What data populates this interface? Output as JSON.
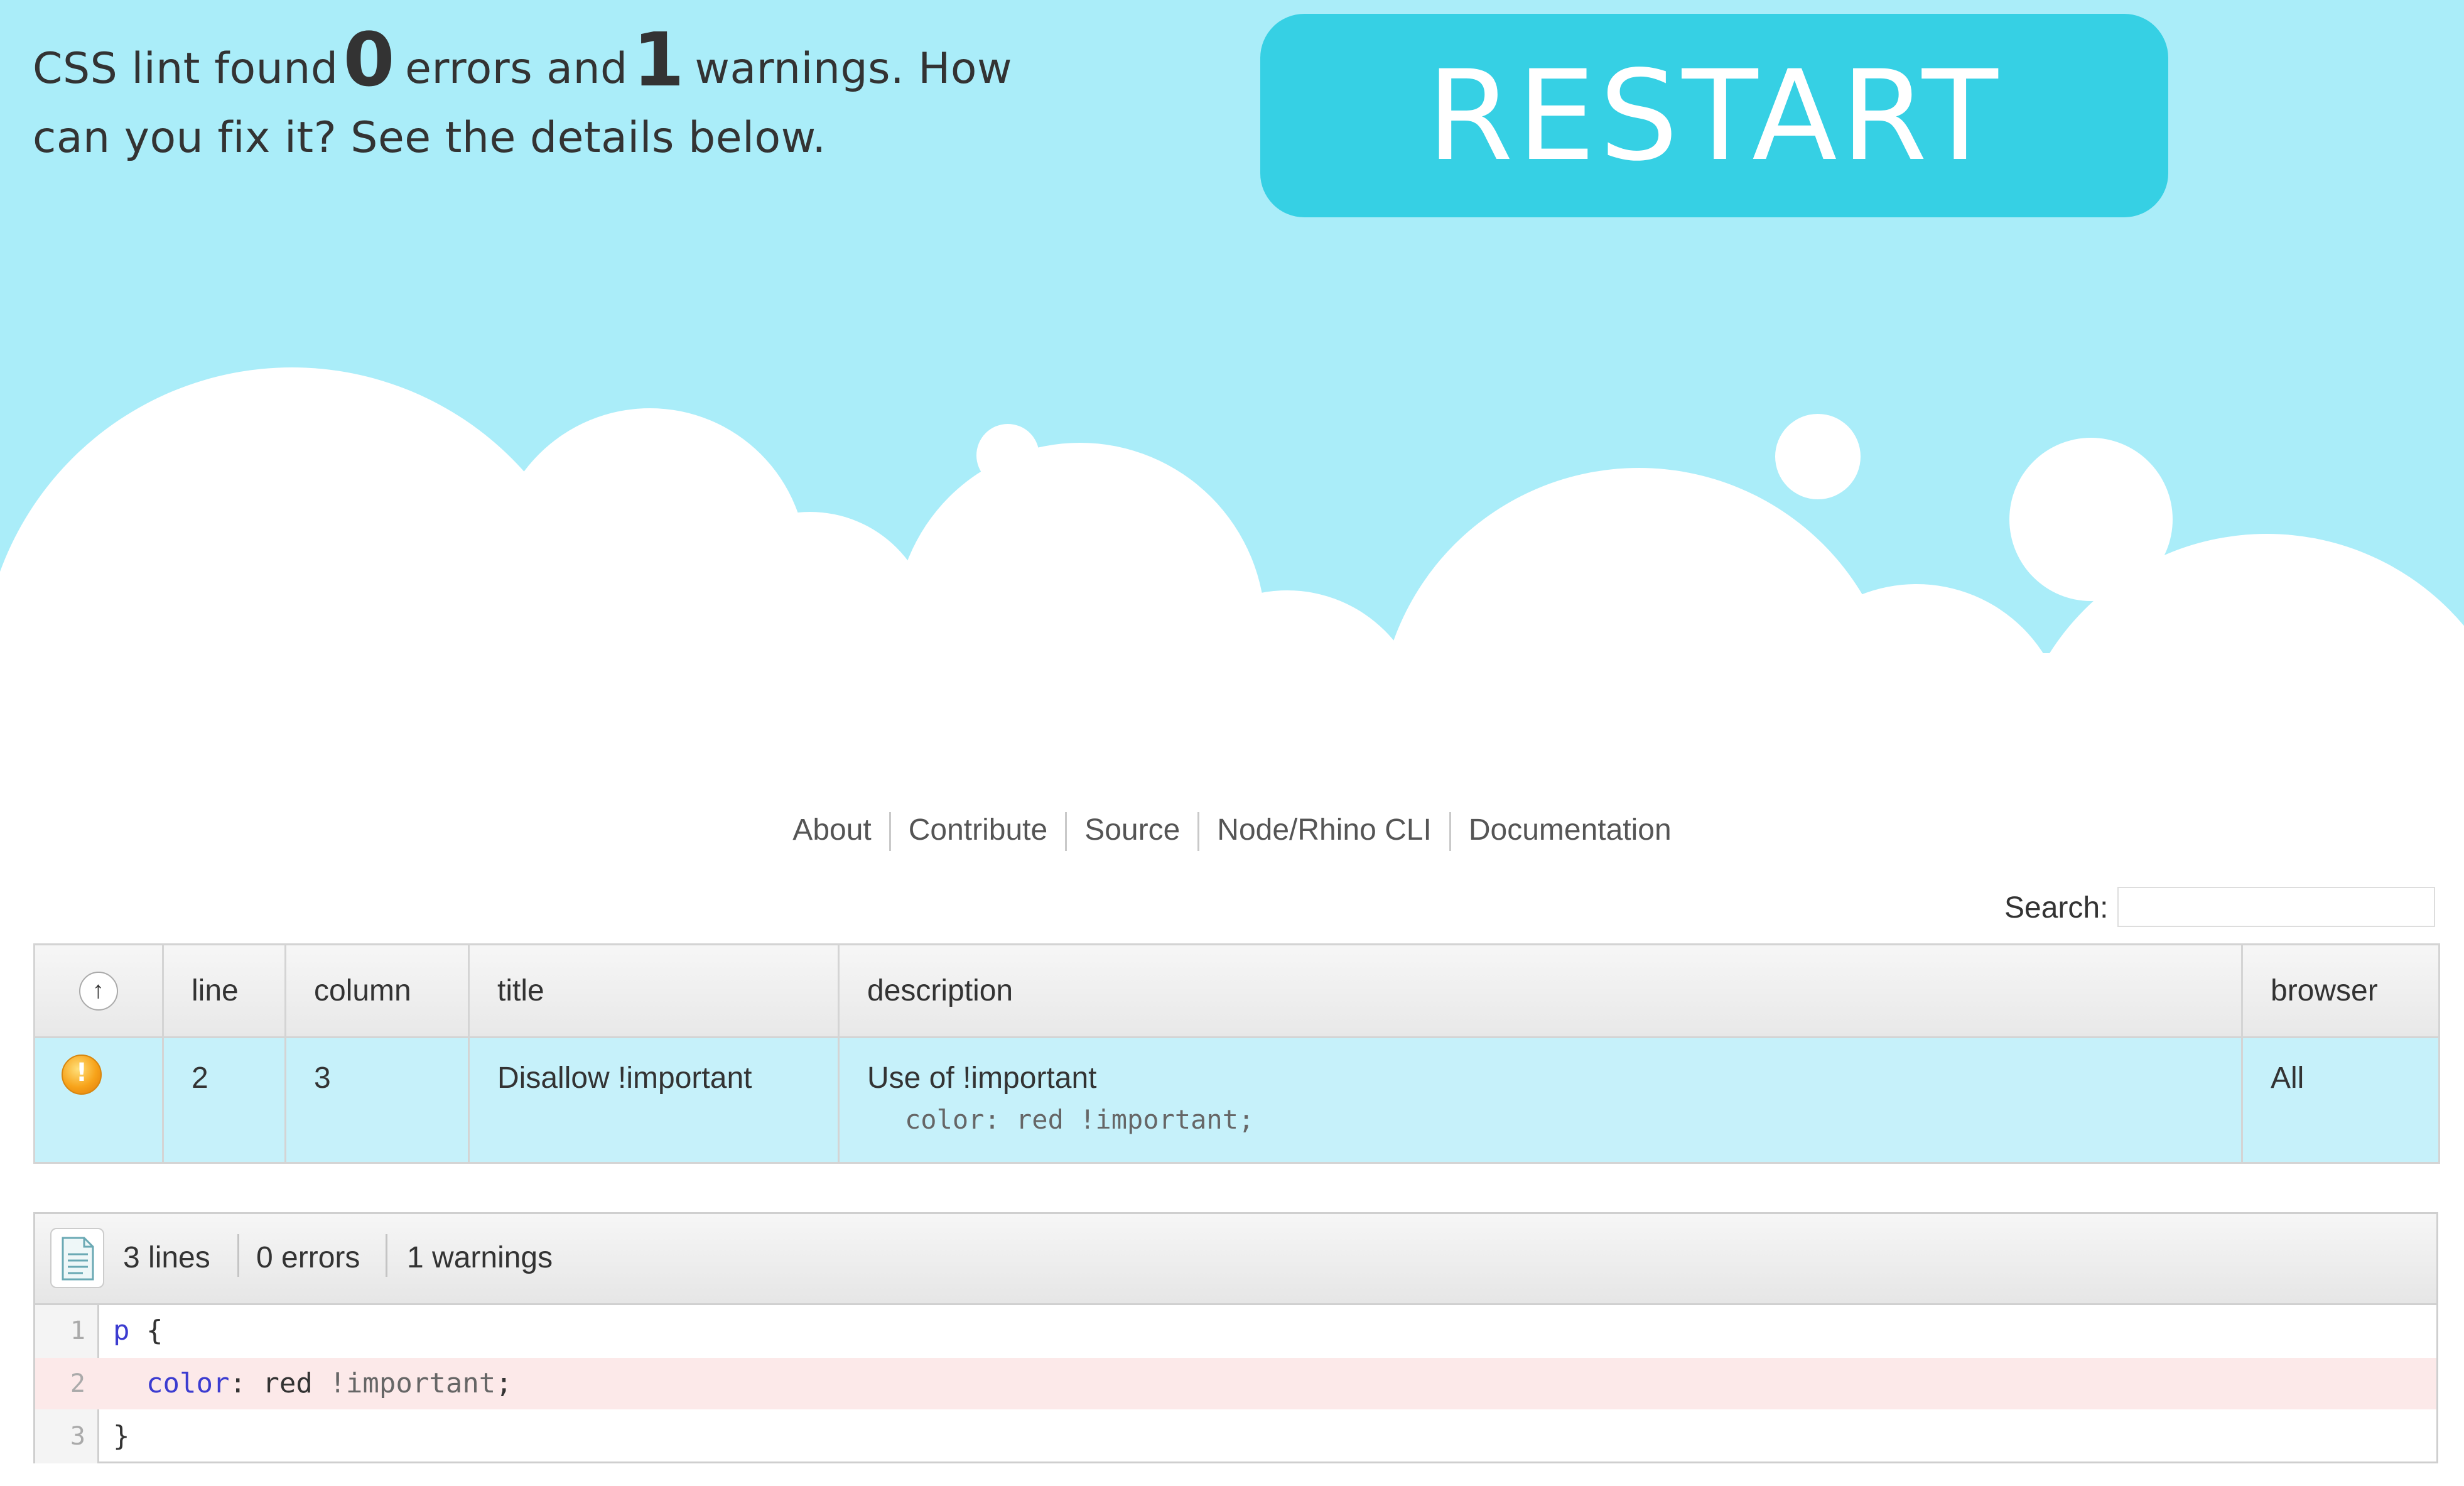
{
  "header": {
    "summary_prefix": "CSS lint found",
    "error_count": "0",
    "summary_mid": "errors and",
    "warning_count": "1",
    "summary_suffix": "warnings. How can you fix it? See the details below.",
    "restart_label": "RESTART",
    "colors": {
      "sky": "#aaedf9",
      "button": "#36d0e4",
      "button_text": "#ffffff"
    }
  },
  "nav": {
    "items": [
      "About",
      "Contribute",
      "Source",
      "Node/Rhino CLI",
      "Documentation"
    ]
  },
  "search": {
    "label": "Search:",
    "value": ""
  },
  "results": {
    "sort_glyph": "↑",
    "columns": [
      "line",
      "column",
      "title",
      "description",
      "browser"
    ],
    "rows": [
      {
        "icon": "warning-icon",
        "line": "2",
        "column": "3",
        "title": "Disallow !important",
        "description": "Use of !important",
        "evidence": "color: red !important;",
        "browser": "All"
      }
    ]
  },
  "viewer": {
    "icon": "document-icon",
    "lines_label": "3 lines",
    "errors_label": "0 errors",
    "warnings_label": "1 warnings",
    "code": [
      {
        "number": "1",
        "parts": [
          "p",
          " {"
        ]
      },
      {
        "number": "2",
        "parts": [
          "  ",
          "color",
          ": red ",
          "!important",
          ";"
        ],
        "highlighted": true
      },
      {
        "number": "3",
        "parts": [
          "}"
        ]
      }
    ]
  }
}
